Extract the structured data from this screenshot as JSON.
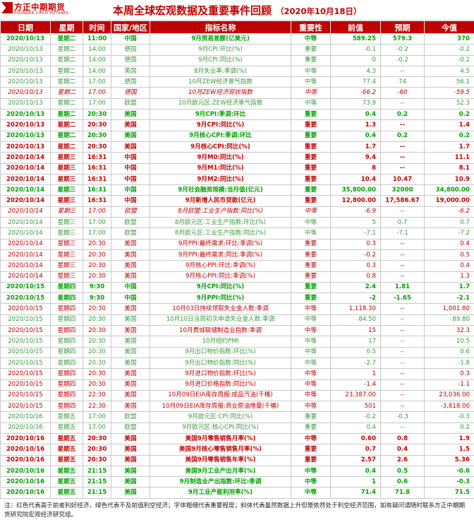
{
  "logo": {
    "cn": "方正中期期货",
    "en": "FOUNDER CIFCO FUTURES"
  },
  "title": "本周全球宏观数据及重要事件回顾",
  "date": "（2020年10月18日）",
  "columns": [
    "日期",
    "星期",
    "时间",
    "国家/地区",
    "指标名称",
    "重要性",
    "前值",
    "预期",
    "今值"
  ],
  "rows": [
    {
      "s": "gb",
      "c": [
        "2020/10/13",
        "星期二",
        "11:00",
        "中国",
        "9月贸易差额(亿美元)",
        "中等",
        "589.25",
        "579.3",
        "370"
      ]
    },
    {
      "s": "g",
      "c": [
        "2020/10/13",
        "星期二",
        "14:00",
        "德国",
        "9月CPI:环比(%)",
        "重要",
        "-0.1",
        "-0.2",
        "-0.2"
      ]
    },
    {
      "s": "g",
      "c": [
        "2020/10/13",
        "星期二",
        "14:00",
        "德国",
        "9月CPI:同比(%)",
        "重要",
        "0",
        "-0.2",
        "-0.2"
      ]
    },
    {
      "s": "g",
      "c": [
        "2020/10/13",
        "星期二",
        "14:00",
        "英国",
        "8月失业率:季调(%)",
        "中等",
        "4.3",
        "--",
        "4.5"
      ]
    },
    {
      "s": "g",
      "c": [
        "2020/10/13",
        "星期二",
        "17:00",
        "德国",
        "10月ZEW经济景气指数",
        "中等",
        "77.4",
        "74",
        "56.1"
      ]
    },
    {
      "s": "ri",
      "c": [
        "2020/10/13",
        "星期二",
        "17:00",
        "德国",
        "10月ZEW经济现状指数",
        "中等",
        "-66.2",
        "-60",
        "-59.5"
      ]
    },
    {
      "s": "g",
      "c": [
        "2020/10/13",
        "星期二",
        "17:00",
        "欧盟",
        "10月欧元区:ZEW经济景气指数",
        "中等",
        "73.9",
        "--",
        "52.3"
      ]
    },
    {
      "s": "gb",
      "c": [
        "2020/10/13",
        "星期二",
        "20:30",
        "美国",
        "9月CPI:季调:环比",
        "重要",
        "0.4",
        "0.2",
        "0.2"
      ]
    },
    {
      "s": "rb",
      "c": [
        "2020/10/13",
        "星期二",
        "20:30",
        "美国",
        "9月CPI:同比(%)",
        "重要",
        "1.3",
        "--",
        "1.4"
      ]
    },
    {
      "s": "gb",
      "c": [
        "2020/10/13",
        "星期二",
        "20:30",
        "美国",
        "9月核心CPI:季调:环比",
        "重要",
        "0.4",
        "0.2",
        "0.2"
      ]
    },
    {
      "s": "rb",
      "c": [
        "2020/10/13",
        "星期二",
        "20:30",
        "美国",
        "9月核心CPI:同比(%)",
        "重要",
        "1.7",
        "--",
        "1.7"
      ]
    },
    {
      "s": "rb",
      "c": [
        "2020/10/14",
        "星期三",
        "16:31",
        "中国",
        "9月M0:同比(%)",
        "重要",
        "9.4",
        "--",
        "11.1"
      ]
    },
    {
      "s": "rb",
      "c": [
        "2020/10/14",
        "星期三",
        "16:31",
        "中国",
        "9月M1:同比(%)",
        "重要",
        "8",
        "--",
        "8.1"
      ]
    },
    {
      "s": "rb",
      "c": [
        "2020/10/14",
        "星期三",
        "16:31",
        "中国",
        "9月M2:同比(%)",
        "重要",
        "10.4",
        "10.47",
        "10.9"
      ]
    },
    {
      "s": "gb",
      "c": [
        "2020/10/14",
        "星期三",
        "16:31",
        "中国",
        "9月社会融资规模:当月值(亿元)",
        "重要",
        "35,800.00",
        "32000",
        "34,800.00"
      ]
    },
    {
      "s": "rb",
      "c": [
        "2020/10/14",
        "星期三",
        "16:31",
        "中国",
        "9月新增人民币贷款(亿元)",
        "重要",
        "12,800.00",
        "17,586.67",
        "19,000.00"
      ]
    },
    {
      "s": "ri",
      "c": [
        "2020/10/14",
        "星期三",
        "17:00",
        "欧盟",
        "8月欧盟:工业生产指数:同比(%)",
        "中等",
        "-6.9",
        "--",
        "-6.2"
      ]
    },
    {
      "s": "g",
      "c": [
        "2020/10/14",
        "星期三",
        "17:00",
        "欧盟",
        "8月欧元区:工业生产指数:环比(%)",
        "中等",
        "5",
        "0.7",
        "0.7"
      ]
    },
    {
      "s": "g",
      "c": [
        "2020/10/14",
        "星期三",
        "17:00",
        "欧盟",
        "8月欧元区:工业生产指数:同比(%)",
        "中等",
        "-7.1",
        "-7.1",
        "-7.2"
      ]
    },
    {
      "s": "r",
      "c": [
        "2020/10/14",
        "星期三",
        "20:30",
        "美国",
        "9月PPI:最终需求:环比:季调(%)",
        "重要",
        "0.3",
        "--",
        "0.4"
      ]
    },
    {
      "s": "r",
      "c": [
        "2020/10/14",
        "星期三",
        "20:30",
        "美国",
        "9月PPI:最终需求:同比:季调(%)",
        "重要",
        "-0.2",
        "--",
        "0.5"
      ]
    },
    {
      "s": "r",
      "c": [
        "2020/10/14",
        "星期三",
        "20:30",
        "美国",
        "9月核心PPI:环比:季调(%)",
        "重要",
        "0.3",
        "--",
        "0.4"
      ]
    },
    {
      "s": "r",
      "c": [
        "2020/10/14",
        "星期三",
        "20:30",
        "美国",
        "9月核心PPI:同比:季调(%)",
        "重要",
        "0.8",
        "--",
        "1.3"
      ]
    },
    {
      "s": "gb",
      "c": [
        "2020/10/15",
        "星期四",
        "9:30",
        "中国",
        "9月CPI:同比(%)",
        "重要",
        "2.4",
        "1.81",
        "1.7"
      ]
    },
    {
      "s": "gb",
      "c": [
        "2020/10/15",
        "星期四",
        "9:30",
        "中国",
        "9月PPI:同比(%)",
        "重要",
        "-2",
        "-1.65",
        "-2.1"
      ]
    },
    {
      "s": "r",
      "c": [
        "2020/10/15",
        "星期四",
        "20:30",
        "美国",
        "10月03日持续领取失业金人数:季调",
        "中等",
        "1,118.30",
        "--",
        "1,001.80"
      ]
    },
    {
      "s": "g",
      "c": [
        "2020/10/15",
        "星期四",
        "20:30",
        "美国",
        "10月10日当周初次申请失业金人数:季调",
        "中等",
        "84.50",
        "--",
        "89.80"
      ]
    },
    {
      "s": "r",
      "c": [
        "2020/10/15",
        "星期四",
        "20:30",
        "美国",
        "10月费城联储制造业指数:季调",
        "中等",
        "15",
        "--",
        "32.3"
      ]
    },
    {
      "s": "g",
      "c": [
        "2020/10/15",
        "星期四",
        "20:30",
        "美国",
        "10月纽约PMI",
        "中等",
        "17",
        "--",
        "10.5"
      ]
    },
    {
      "s": "g",
      "c": [
        "2020/10/15",
        "星期四",
        "20:30",
        "美国",
        "9月出口物价指数:环比(%)",
        "中等",
        "0.5",
        "--",
        "0.6"
      ]
    },
    {
      "s": "g",
      "c": [
        "2020/10/15",
        "星期四",
        "20:30",
        "美国",
        "9月出口物价指数:同比(%)",
        "中等",
        "-2.7",
        "--",
        "-1.8"
      ]
    },
    {
      "s": "r",
      "c": [
        "2020/10/15",
        "星期四",
        "20:30",
        "美国",
        "9月进口物价指数:环比(%)",
        "中等",
        "1",
        "--",
        "0.3"
      ]
    },
    {
      "s": "r",
      "c": [
        "2020/10/15",
        "星期四",
        "20:30",
        "美国",
        "9月进口价格指数:同比(%)",
        "中等",
        "-1.4",
        "--",
        "-1.1"
      ]
    },
    {
      "s": "r",
      "c": [
        "2020/10/15",
        "星期四",
        "22:30",
        "美国",
        "10月09日EIA库存周报:成品汽油(千桶)",
        "中等",
        "23,387.00",
        "--",
        "23,036.00"
      ]
    },
    {
      "s": "r",
      "c": [
        "2020/10/15",
        "星期四",
        "22:30",
        "美国",
        "10月09日EIA库存周报:商业原油增量(千桶)",
        "中等",
        "501",
        "--",
        "-3,818.00"
      ]
    },
    {
      "s": "g",
      "c": [
        "2020/10/16",
        "星期五",
        "17:00",
        "欧盟",
        "9月欧元区:CPI:同比(%)",
        "重要",
        "-0.2",
        "-0.3",
        "-0.3"
      ]
    },
    {
      "s": "g",
      "c": [
        "2020/10/16",
        "星期五",
        "17:00",
        "欧盟",
        "9月欧元区:核心CPI:同比(%)",
        "重要",
        "0.4",
        "--",
        "0.2"
      ]
    },
    {
      "s": "rb",
      "c": [
        "2020/10/16",
        "星期五",
        "20:30",
        "美国",
        "美国9月零售销售月率(%)",
        "中等",
        "0.60",
        "0.8",
        "1.9"
      ]
    },
    {
      "s": "rb",
      "c": [
        "2020/10/16",
        "星期五",
        "20:30",
        "美国",
        "美国9月核心零售销售月率(%)",
        "重要",
        "0.7",
        "0.4",
        "1.5"
      ]
    },
    {
      "s": "rb",
      "c": [
        "2020/10/16",
        "星期五",
        "20:30",
        "美国",
        "美国9月零售销售年率(%)",
        "重要",
        "2.57",
        "2.6",
        "5.36"
      ]
    },
    {
      "s": "gb",
      "c": [
        "2020/10/16",
        "星期五",
        "21:15",
        "美国",
        "美国9月工业产出月率(%)",
        "中等",
        "0.4",
        "0.5",
        "-0.6"
      ]
    },
    {
      "s": "gb",
      "c": [
        "2020/10/16",
        "星期五",
        "21:15",
        "美国",
        "9月制造业产出指数:环比:季调",
        "中等",
        "1",
        "0.6",
        "-0.3"
      ]
    },
    {
      "s": "gb",
      "c": [
        "2020/10/16",
        "星期五",
        "21:15",
        "美国",
        "9月工业产能利用率(%)",
        "中等",
        "71.4",
        "71.8",
        "71.5"
      ]
    }
  ],
  "footer": "注：红色代表高于前者利好经济，绿色代表不及前值利空经济；字体粗细代表重要程度；斜体代表虽然数据上升但是依然处于利空经济范围，如有疑问请随时联系方正中期期货研究院宏观经济研究组。"
}
